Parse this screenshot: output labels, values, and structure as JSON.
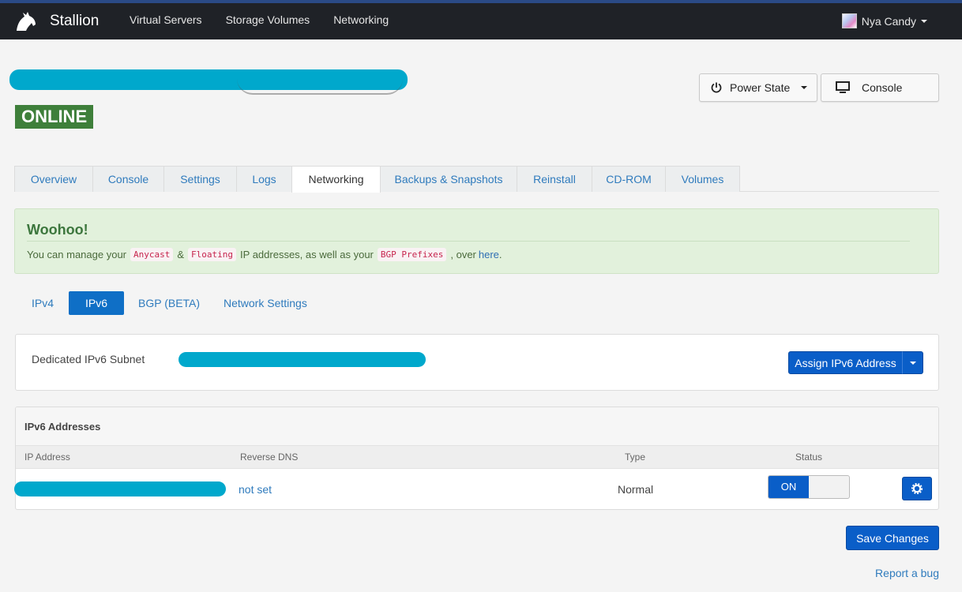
{
  "brand": {
    "name": "Stallion"
  },
  "nav": [
    "Virtual Servers",
    "Storage Volumes",
    "Networking"
  ],
  "user": {
    "name": "Nya Candy"
  },
  "server": {
    "status": "ONLINE"
  },
  "actions": {
    "power_state": "Power State",
    "console": "Console"
  },
  "tabs": [
    "Overview",
    "Console",
    "Settings",
    "Logs",
    "Networking",
    "Backups & Snapshots",
    "Reinstall",
    "CD-ROM",
    "Volumes"
  ],
  "alert": {
    "title": "Woohoo!",
    "text_before": "You can manage your",
    "code_anycast": "Anycast",
    "amp": "&",
    "code_floating": "Floating",
    "text_mid": "IP addresses, as well as your",
    "code_bgp": "BGP Prefixes",
    "text_after": ", over",
    "link": "here",
    "period": "."
  },
  "subtabs": [
    "IPv4",
    "IPv6",
    "BGP (BETA)",
    "Network Settings"
  ],
  "subnet": {
    "label": "Dedicated IPv6 Subnet",
    "assign_button": "Assign IPv6 Address"
  },
  "addresses": {
    "title": "IPv6 Addresses",
    "columns": [
      "IP Address",
      "Reverse DNS",
      "Type",
      "Status"
    ],
    "row": {
      "rdns": "not set",
      "type": "Normal",
      "status": "ON"
    }
  },
  "save_button": "Save Changes",
  "report_link": "Report a bug",
  "colors": {
    "topbar": "#1f2227",
    "accent": "#0a5ec8",
    "online": "#3e7f3a",
    "redaction": "#00a8cc",
    "alert_bg": "#e2f1dc"
  }
}
